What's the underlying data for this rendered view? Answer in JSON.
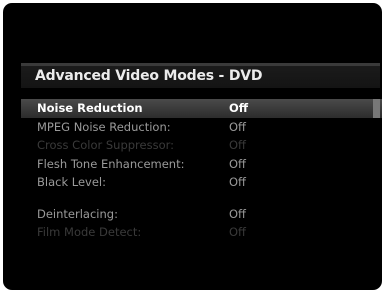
{
  "menu": {
    "title": "Advanced Video Modes - DVD",
    "options": [
      {
        "label": "Noise Reduction",
        "value": "Off",
        "state": "selected"
      },
      {
        "label": "MPEG Noise Reduction:",
        "value": "Off",
        "state": "normal"
      },
      {
        "label": "Cross Color Suppressor:",
        "value": "Off",
        "state": "disabled"
      },
      {
        "label": "Flesh Tone Enhancement:",
        "value": "Off",
        "state": "normal"
      },
      {
        "label": "Black Level:",
        "value": "Off",
        "state": "normal"
      },
      {
        "label": "Deinterlacing:",
        "value": "Off",
        "state": "normal"
      },
      {
        "label": "Film Mode Detect:",
        "value": "Off",
        "state": "disabled"
      }
    ]
  },
  "colors": {
    "background": "#000000",
    "text_normal": "#9a9a9a",
    "text_selected": "#ffffff",
    "text_disabled": "#3a3a3a",
    "highlight": "#4a4a4a"
  }
}
